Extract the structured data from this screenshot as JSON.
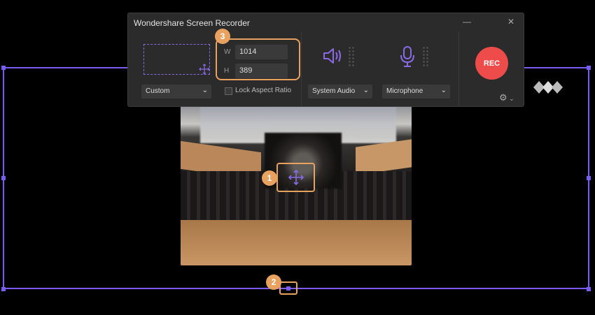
{
  "window": {
    "title": "Wondershare Screen Recorder",
    "minimize_glyph": "—",
    "close_glyph": "✕"
  },
  "dimensions": {
    "width_label": "W",
    "width_value": "1014",
    "height_label": "H",
    "height_value": "389",
    "lock_label": "Lock Aspect Ratio",
    "lock_checked": false
  },
  "area_select": {
    "value": "Custom"
  },
  "audio": {
    "system_select": "System Audio",
    "mic_select": "Microphone"
  },
  "record": {
    "label": "REC"
  },
  "callouts": {
    "one": "1",
    "two": "2",
    "three": "3"
  },
  "colors": {
    "accent": "#7c5cf0",
    "highlight": "#e8a15e",
    "rec": "#ee4b4b",
    "panel": "#2b2b2b"
  },
  "icons": [
    "move-icon",
    "speaker-icon",
    "microphone-icon",
    "settings-icon",
    "chevron-down-icon",
    "close-icon",
    "minimize-icon",
    "wondershare-logo"
  ]
}
